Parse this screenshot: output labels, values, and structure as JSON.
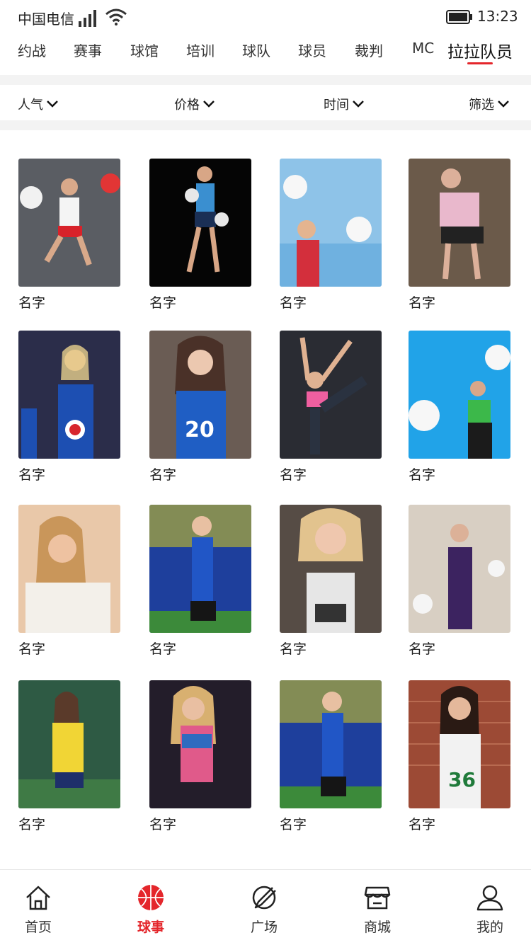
{
  "status_bar": {
    "carrier": "中国电信",
    "time": "13:23"
  },
  "tabs": [
    {
      "label": "约战"
    },
    {
      "label": "赛事"
    },
    {
      "label": "球馆"
    },
    {
      "label": "培训"
    },
    {
      "label": "球队"
    },
    {
      "label": "球员"
    },
    {
      "label": "裁判"
    },
    {
      "label": "MC"
    },
    {
      "label": "拉拉队员",
      "active": true
    }
  ],
  "filters": [
    {
      "label": "人气"
    },
    {
      "label": "价格"
    },
    {
      "label": "时间"
    },
    {
      "label": "筛选"
    }
  ],
  "cheerleaders": [
    {
      "name": "名字"
    },
    {
      "name": "名字"
    },
    {
      "name": "名字"
    },
    {
      "name": "名字"
    },
    {
      "name": "名字"
    },
    {
      "name": "名字"
    },
    {
      "name": "名字"
    },
    {
      "name": "名字"
    },
    {
      "name": "名字"
    },
    {
      "name": "名字"
    },
    {
      "name": "名字"
    },
    {
      "name": "名字"
    },
    {
      "name": "名字"
    },
    {
      "name": "名字"
    },
    {
      "name": "名字"
    },
    {
      "name": "名字"
    }
  ],
  "bottom_nav": [
    {
      "label": "首页",
      "icon": "home-icon"
    },
    {
      "label": "球事",
      "icon": "basketball-icon",
      "active": true
    },
    {
      "label": "广场",
      "icon": "compass-icon"
    },
    {
      "label": "商城",
      "icon": "store-icon"
    },
    {
      "label": "我的",
      "icon": "user-icon"
    }
  ],
  "colors": {
    "accent": "#e4262b",
    "separator": "#f3f3f3"
  }
}
